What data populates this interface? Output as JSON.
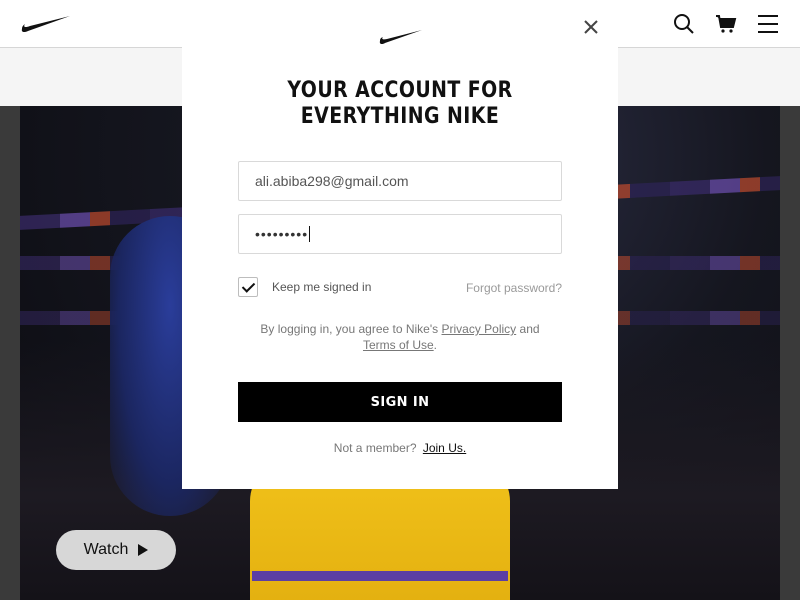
{
  "topbar": {
    "icons": [
      "nike-swoosh-icon",
      "search-icon",
      "cart-icon",
      "menu-icon"
    ]
  },
  "hero": {
    "watch_label": "Watch"
  },
  "modal": {
    "title_line1": "YOUR ACCOUNT FOR",
    "title_line2": "EVERYTHING NIKE",
    "email_value": "ali.abiba298@gmail.com",
    "password_value": "•••••••••",
    "keep_signed_in_label": "Keep me signed in",
    "keep_signed_in_checked": true,
    "forgot_password_label": "Forgot password?",
    "legal_prefix": "By logging in, you agree to Nike's",
    "privacy_policy_label": "Privacy Policy",
    "legal_and": "and",
    "terms_label": "Terms of Use",
    "legal_suffix": ".",
    "sign_in_label": "SIGN IN",
    "not_member_label": "Not a member?",
    "join_label": "Join Us."
  },
  "colors": {
    "primary_button": "#000000",
    "accent_yellow": "#f1c21a",
    "accent_purple": "#5b3ea3"
  }
}
